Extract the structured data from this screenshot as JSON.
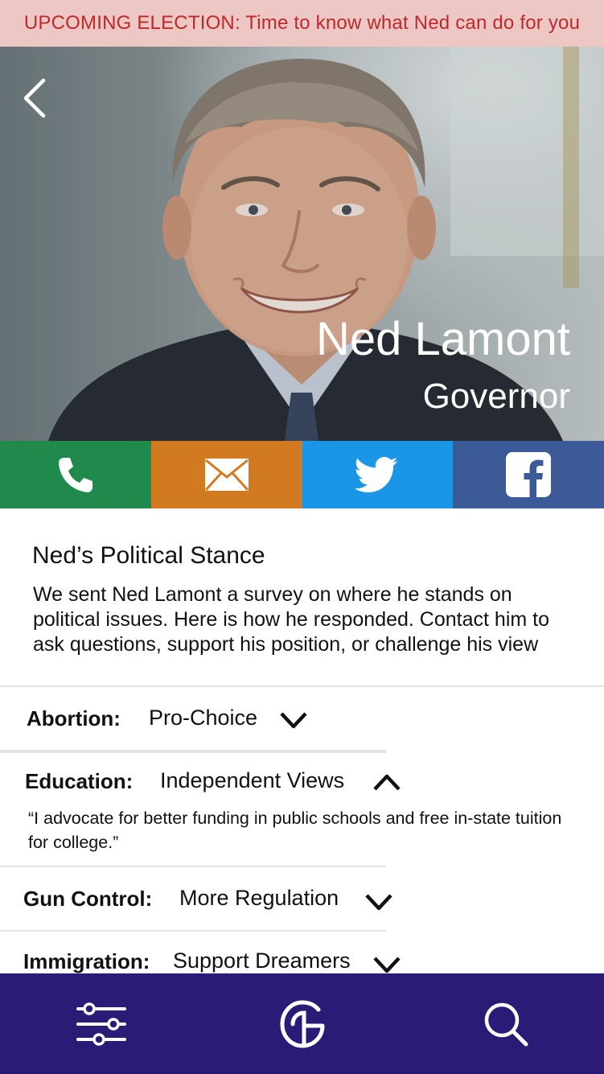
{
  "banner": {
    "text": "UPCOMING ELECTION: Time to know what Ned can do for you"
  },
  "profile": {
    "name": "Ned Lamont",
    "title": "Governor"
  },
  "contact": [
    {
      "icon": "phone-icon",
      "color": "#1f8a4c"
    },
    {
      "icon": "mail-icon",
      "color": "#d17a1f"
    },
    {
      "icon": "twitter-icon",
      "color": "#1b96e6"
    },
    {
      "icon": "facebook-icon",
      "color": "#3c5a98"
    }
  ],
  "stance": {
    "heading": "Ned’s Political Stance",
    "description": "We sent Ned Lamont a survey on where he stands on political issues. Here is how he responded. Contact him to ask questions, support his position, or challenge his view"
  },
  "issues": [
    {
      "topic": "Abortion:",
      "position": "Pro-Choice",
      "expanded": false
    },
    {
      "topic": "Education:",
      "position": "Independent Views",
      "expanded": true,
      "quote": "“I advocate for better funding in public schools and free in-state tuition for college.”"
    },
    {
      "topic": "Gun Control:",
      "position": "More Regulation",
      "expanded": false
    },
    {
      "topic": "Immigration:",
      "position": "Support Dreamers",
      "expanded": false
    }
  ],
  "nav": {
    "items": [
      "filter-icon",
      "logo-icon",
      "search-icon"
    ],
    "background": "#2c1b76"
  },
  "colors": {
    "banner_bg": "#ecc7c4",
    "banner_text": "#c0282b"
  }
}
